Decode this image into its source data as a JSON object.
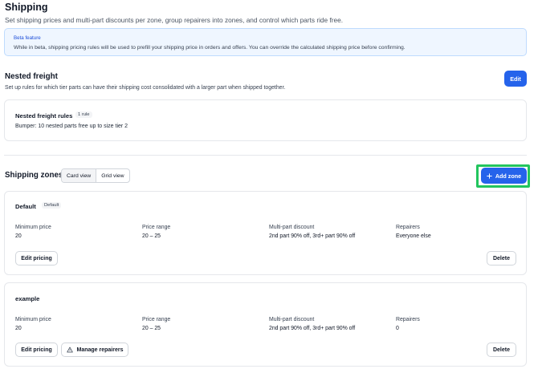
{
  "header": {
    "title": "Shipping",
    "subtitle": "Set shipping prices and multi-part discounts per zone, group repairers into zones, and control which parts ride free."
  },
  "beta": {
    "title": "Beta feature",
    "text": "While in beta, shipping pricing rules will be used to prefill your shipping price in orders and offers. You can override the calculated shipping price before confirming."
  },
  "nested_freight": {
    "title": "Nested freight",
    "description": "Set up rules for which tier parts can have their shipping cost consolidated with a larger part when shipped together.",
    "edit_label": "Edit",
    "rules_title": "Nested freight rules",
    "rules_count": "1 rule",
    "rule_text": "Bumper: 10 nested parts free up to size tier 2"
  },
  "zones": {
    "title": "Shipping zones",
    "view_card": "Card view",
    "view_grid": "Grid view",
    "add_label": "Add zone",
    "items": [
      {
        "name": "Default",
        "badge": "Default",
        "min_price_label": "Minimum price",
        "min_price": "20",
        "range_label": "Price range",
        "range": "20 – 25",
        "discount_label": "Multi-part discount",
        "discount": "2nd part 90% off, 3rd+ part 90% off",
        "repairers_label": "Repairers",
        "repairers": "Everyone else",
        "edit_label": "Edit pricing",
        "delete_label": "Delete"
      },
      {
        "name": "example",
        "min_price_label": "Minimum price",
        "min_price": "20",
        "range_label": "Price range",
        "range": "20 – 25",
        "discount_label": "Multi-part discount",
        "discount": "2nd part 90% off, 3rd+ part 90% off",
        "repairers_label": "Repairers",
        "repairers": "0",
        "edit_label": "Edit pricing",
        "manage_label": "Manage repairers",
        "delete_label": "Delete"
      }
    ]
  },
  "colors": {
    "primary": "#2563eb",
    "beta_bg": "#eff6ff",
    "focus": "#22c55e"
  }
}
